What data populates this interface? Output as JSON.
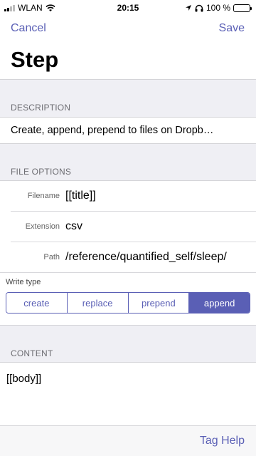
{
  "status": {
    "carrier": "WLAN",
    "time": "20:15",
    "battery": "100 %",
    "battery_level": 1.0
  },
  "nav": {
    "cancel": "Cancel",
    "save": "Save",
    "title": "Step"
  },
  "description": {
    "header": "DESCRIPTION",
    "text": "Create, append, prepend to files on Dropb…"
  },
  "file_options": {
    "header": "FILE OPTIONS",
    "filename_label": "Filename",
    "filename_value": "[[title]]",
    "extension_label": "Extension",
    "extension_value": "csv",
    "path_label": "Path",
    "path_value": "/reference/quantified_self/sleep/"
  },
  "write_type": {
    "label": "Write type",
    "options": [
      "create",
      "replace",
      "prepend",
      "append"
    ],
    "selected": "append"
  },
  "content": {
    "header": "CONTENT",
    "text": "[[body]]"
  },
  "footer": {
    "tag_help": "Tag Help"
  },
  "colors": {
    "accent": "#5a5fb5",
    "background_gray": "#efeff4",
    "battery_green": "#3cc83c"
  },
  "icons": [
    "signal-icon",
    "wifi-icon",
    "location-icon",
    "headphones-icon",
    "battery-icon"
  ]
}
